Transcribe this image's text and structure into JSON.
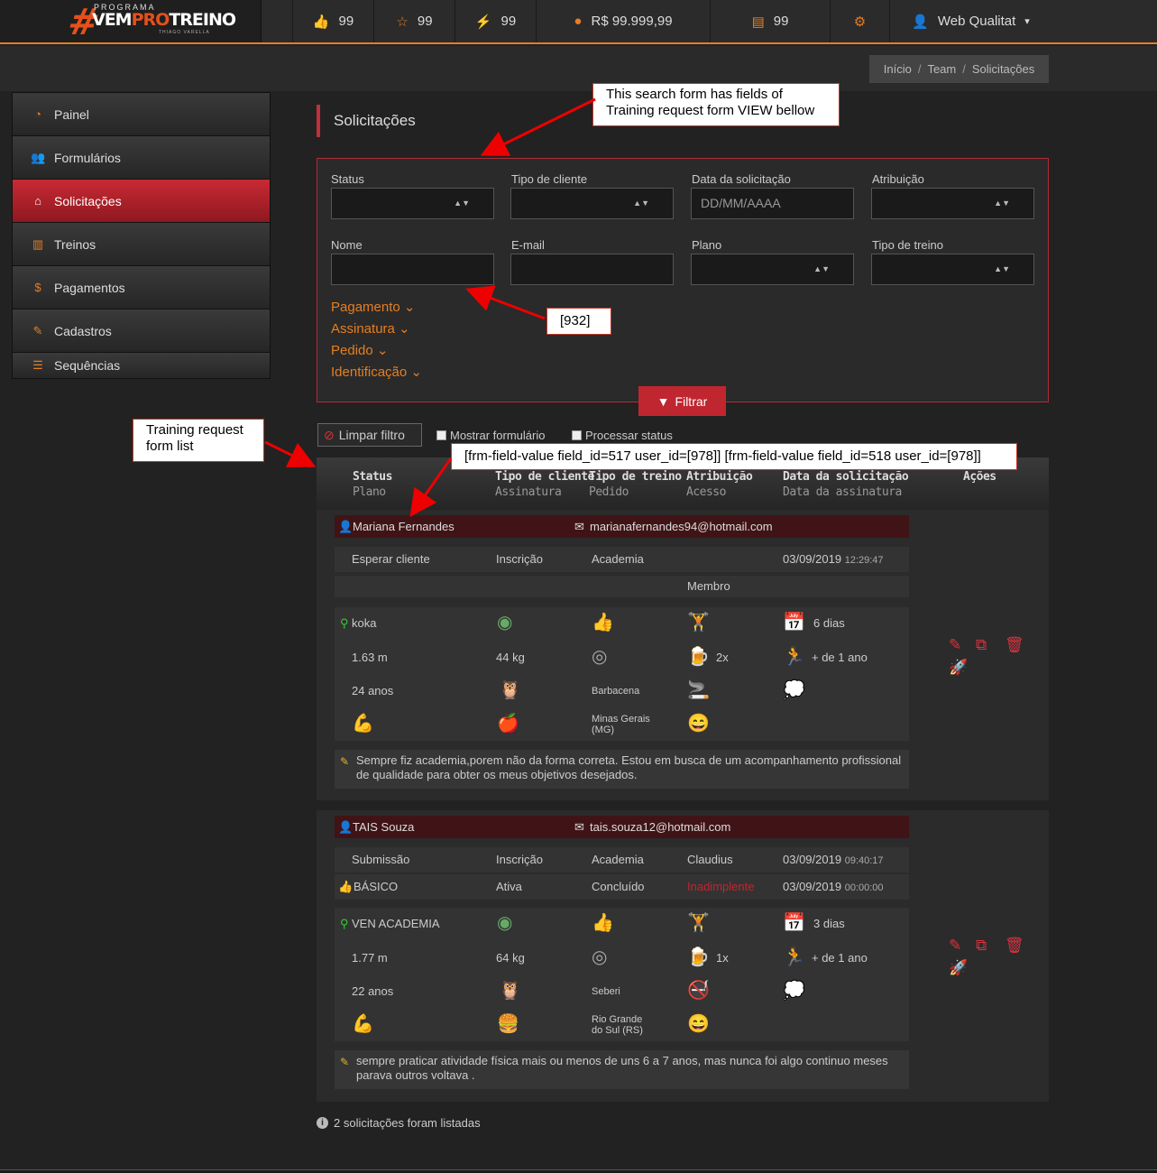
{
  "header": {
    "logo": {
      "small": "PROGRAMA",
      "name_a": "VEM",
      "name_b": "PRO",
      "name_c": "TREINO",
      "sub": "THIAGO VARELLA"
    },
    "stats": [
      {
        "icon": "thumbs-up-icon",
        "value": "99"
      },
      {
        "icon": "star-icon",
        "value": "99"
      },
      {
        "icon": "bolt-icon",
        "value": "99"
      },
      {
        "icon": "money-icon",
        "value": "R$ 99.999,99"
      },
      {
        "icon": "document-icon",
        "value": "99"
      }
    ],
    "user": "Web Qualitat"
  },
  "breadcrumb": {
    "home": "Início",
    "team": "Team",
    "current": "Solicitações"
  },
  "sidebar": {
    "items": [
      {
        "label": "Painel",
        "icon": "dashboard-icon"
      },
      {
        "label": "Formulários",
        "icon": "users-icon"
      },
      {
        "label": "Solicitações",
        "icon": "inbox-icon"
      },
      {
        "label": "Treinos",
        "icon": "bar-chart-icon"
      },
      {
        "label": "Pagamentos",
        "icon": "money-icon"
      },
      {
        "label": "Cadastros",
        "icon": "edit-icon"
      },
      {
        "label": "Sequências",
        "icon": "list-icon"
      }
    ]
  },
  "page": {
    "title": "Solicitações"
  },
  "filter": {
    "status_label": "Status",
    "tipo_cliente_label": "Tipo de cliente",
    "data_label": "Data da solicitação",
    "data_placeholder": "DD/MM/AAAA",
    "atribuicao_label": "Atribuição",
    "nome_label": "Nome",
    "email_label": "E-mail",
    "plano_label": "Plano",
    "tipo_treino_label": "Tipo de treino",
    "sections": [
      "Pagamento",
      "Assinatura",
      "Pedido",
      "Identificação"
    ],
    "button": "Filtrar",
    "clear": "Limpar filtro",
    "show_form": "Mostrar formulário",
    "process_status": "Processar status"
  },
  "table_header": {
    "status": "Status",
    "plano": "Plano",
    "tipo_cliente": "Tipo de cliente",
    "assinatura": "Assinatura",
    "tipo_treino": "Tipo de treino",
    "pedido": "Pedido",
    "atribuicao": "Atribuição",
    "acesso": "Acesso",
    "data_solicitacao": "Data da solicitação",
    "data_assinatura": "Data da assinatura",
    "acoes": "Ações"
  },
  "requests": [
    {
      "name": "Mariana Fernandes",
      "email": "marianafernandes94@hotmail.com",
      "status": "Esperar cliente",
      "tipo_cliente": "Inscrição",
      "tipo_treino": "Academia",
      "date": "03/09/2019",
      "time": "12:29:47",
      "membro": "Membro",
      "plan_name": "koka",
      "dias": "6 dias",
      "height": "1.63 m",
      "weight": "44 kg",
      "beer": "2x",
      "experience": "+ de 1 ano",
      "age": "24 anos",
      "city": "Barbacena",
      "state": "Minas Gerais (MG)",
      "note": "Sempre fiz academia,porem não da forma correta. Estou em busca de um acompanhamento profissional de qualidade para obter os meus objetivos desejados."
    },
    {
      "name": "TAIS Souza",
      "email": "tais.souza12@hotmail.com",
      "status": "Submissão",
      "tipo_cliente": "Inscrição",
      "tipo_treino": "Academia",
      "atribuicao": "Claudius",
      "date": "03/09/2019",
      "time": "09:40:17",
      "plano": "BÁSICO",
      "assinatura": "Ativa",
      "pedido": "Concluído",
      "acesso": "Inadimplente",
      "date2": "03/09/2019",
      "time2": "00:00:00",
      "plan_name": "VEN ACADEMIA",
      "dias": "3 dias",
      "height": "1.77 m",
      "weight": "64 kg",
      "beer": "1x",
      "experience": "+ de 1 ano",
      "age": "22 anos",
      "city": "Seberi",
      "state": "Rio Grande do Sul (RS)",
      "note": "sempre praticar atividade física mais ou menos de uns 6 a 7 anos, mas nunca foi algo continuo meses parava outros voltava ."
    }
  ],
  "footer": {
    "text": "2 solicitações foram listadas"
  },
  "annotations": {
    "search_form": "This search form has fields of Training request form VIEW bellow",
    "field_id": "[932]",
    "list": "Training request form list",
    "shortcode": "[frm-field-value field_id=517 user_id=[978]] [frm-field-value field_id=518 user_id=[978]]"
  },
  "colors": {
    "accent": "#e67e22",
    "brand_red": "#c0262f",
    "danger": "#d9333f"
  }
}
